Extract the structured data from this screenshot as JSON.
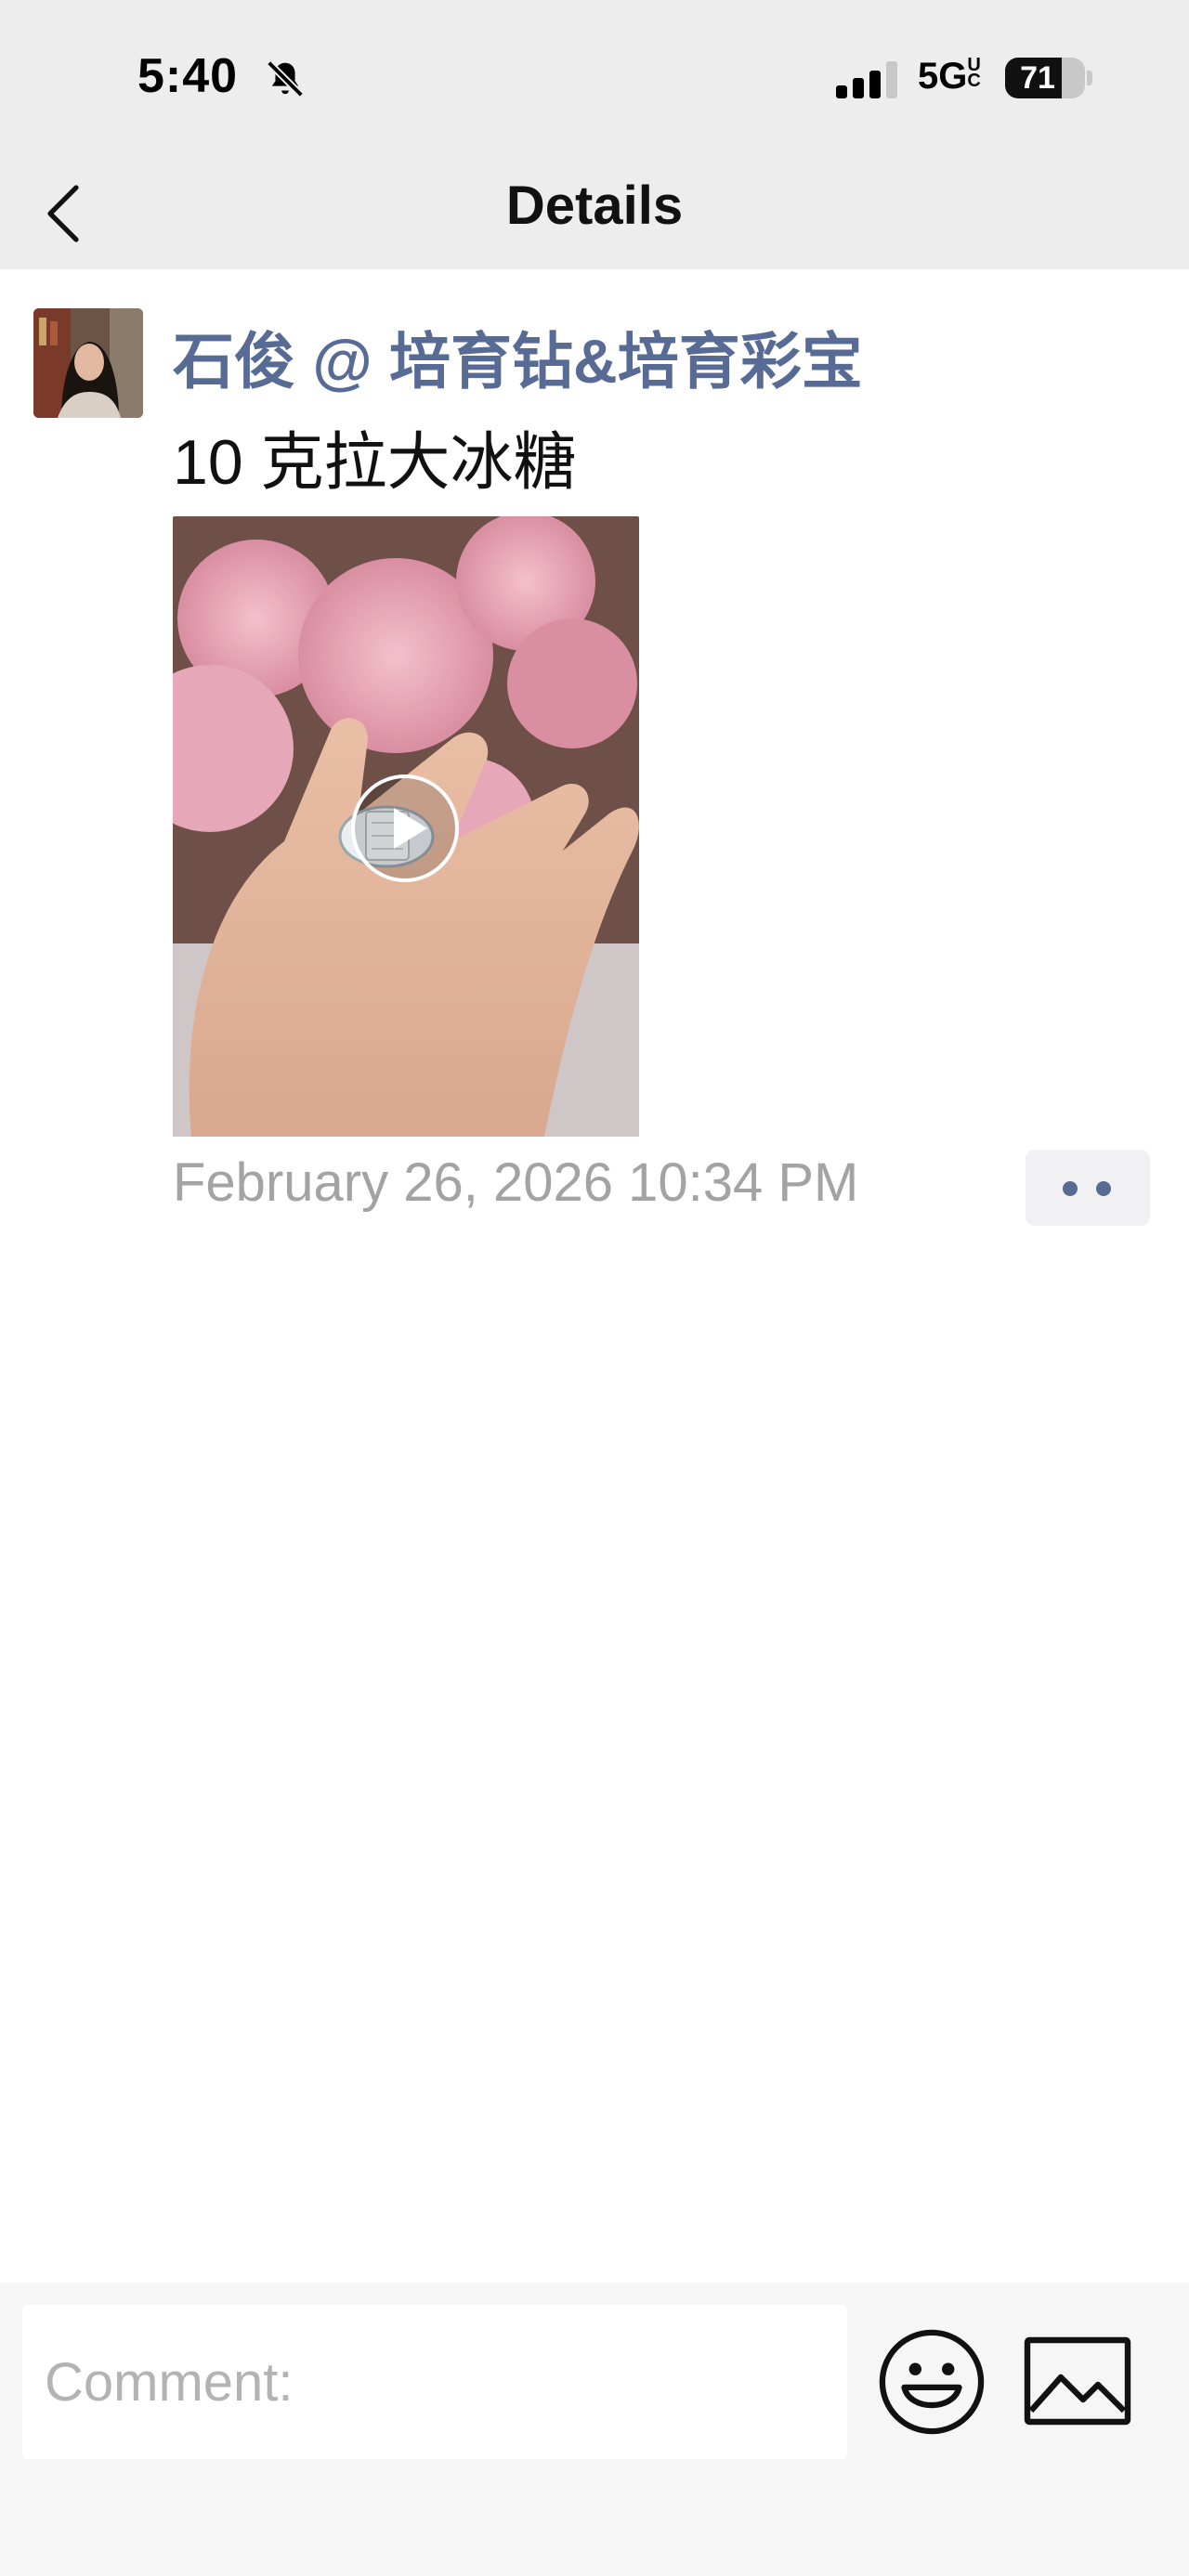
{
  "status_bar": {
    "time": "5:40",
    "network": "5G",
    "network_badge": "UC",
    "battery": "71",
    "battery_level": 0.71,
    "icons": [
      "bell-slash-icon",
      "signal-icon"
    ]
  },
  "nav": {
    "title": "Details",
    "back_icon": "chevron-left-icon"
  },
  "post": {
    "author": "石俊 @ 培育钻&培育彩宝",
    "text": "10 克拉大冰糖",
    "media_type": "video",
    "timestamp": "February 26, 2026 10:34 PM",
    "more_icon": "two-dots-icon"
  },
  "comment_bar": {
    "placeholder": "Comment:",
    "emoji_icon": "smiley-icon",
    "image_icon": "image-icon"
  },
  "colors": {
    "author": "#576b95",
    "timestamp": "#a3a3a3",
    "bar_background": "#ededed"
  }
}
